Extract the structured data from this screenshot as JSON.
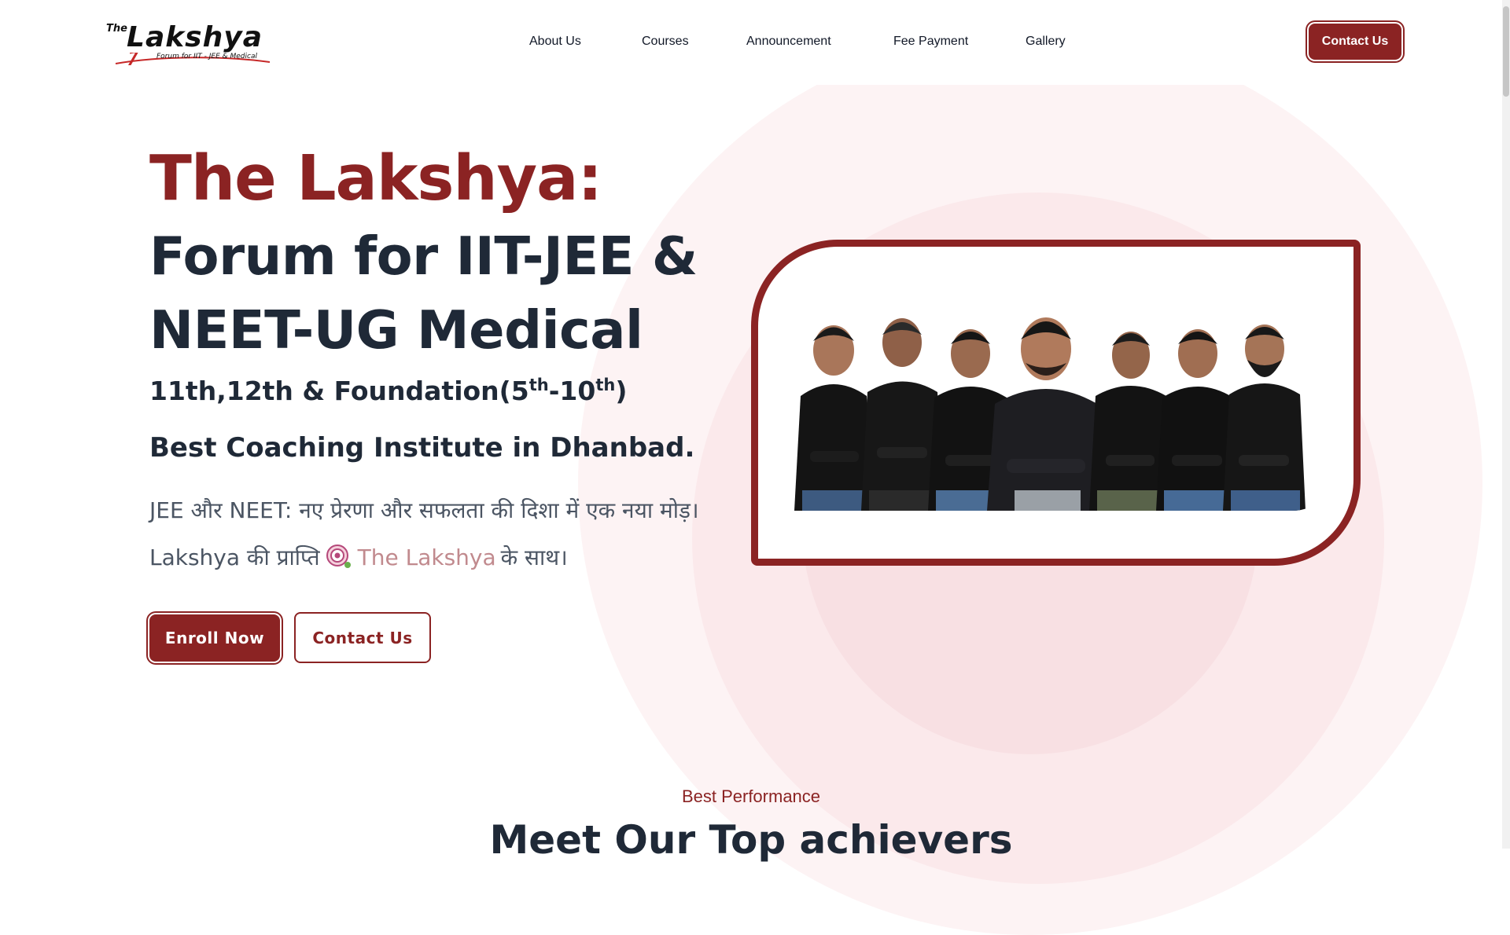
{
  "header": {
    "logo_the": "The",
    "logo_word": "Lakshya",
    "logo_tagline": "Forum for IIT - JEE & Medical",
    "nav": [
      "About Us",
      "Courses",
      "Announcement",
      "Fee Payment",
      "Gallery"
    ],
    "contact_label": "Contact Us"
  },
  "hero": {
    "title": "The Lakshya:",
    "subtitle_line1": "Forum for IIT-JEE &",
    "subtitle_line2": "NEET-UG Medical",
    "classes_main": "11th,12th & Foundation(5",
    "classes_sup1": "th",
    "classes_mid": "-10",
    "classes_sup2": "th",
    "classes_end": ")",
    "best": "Best Coaching Institute in Dhanbad.",
    "line1": "JEE और NEET: नए प्रेरणा और सफलता की दिशा में एक नया मोड़।",
    "line2_prefix": "Lakshya की प्राप्ति",
    "line2_brand": "The Lakshya",
    "line2_suffix": "के साथ।",
    "enroll_label": "Enroll Now",
    "contact_label": "Contact Us"
  },
  "section": {
    "tag": "Best Performance",
    "title": "Meet Our Top achievers"
  },
  "icons": [
    "target-icon"
  ],
  "colors": {
    "brand": "#8b2323",
    "text": "#1f2937",
    "muted": "#4b5563",
    "accent_pink": "#c18a8e"
  }
}
